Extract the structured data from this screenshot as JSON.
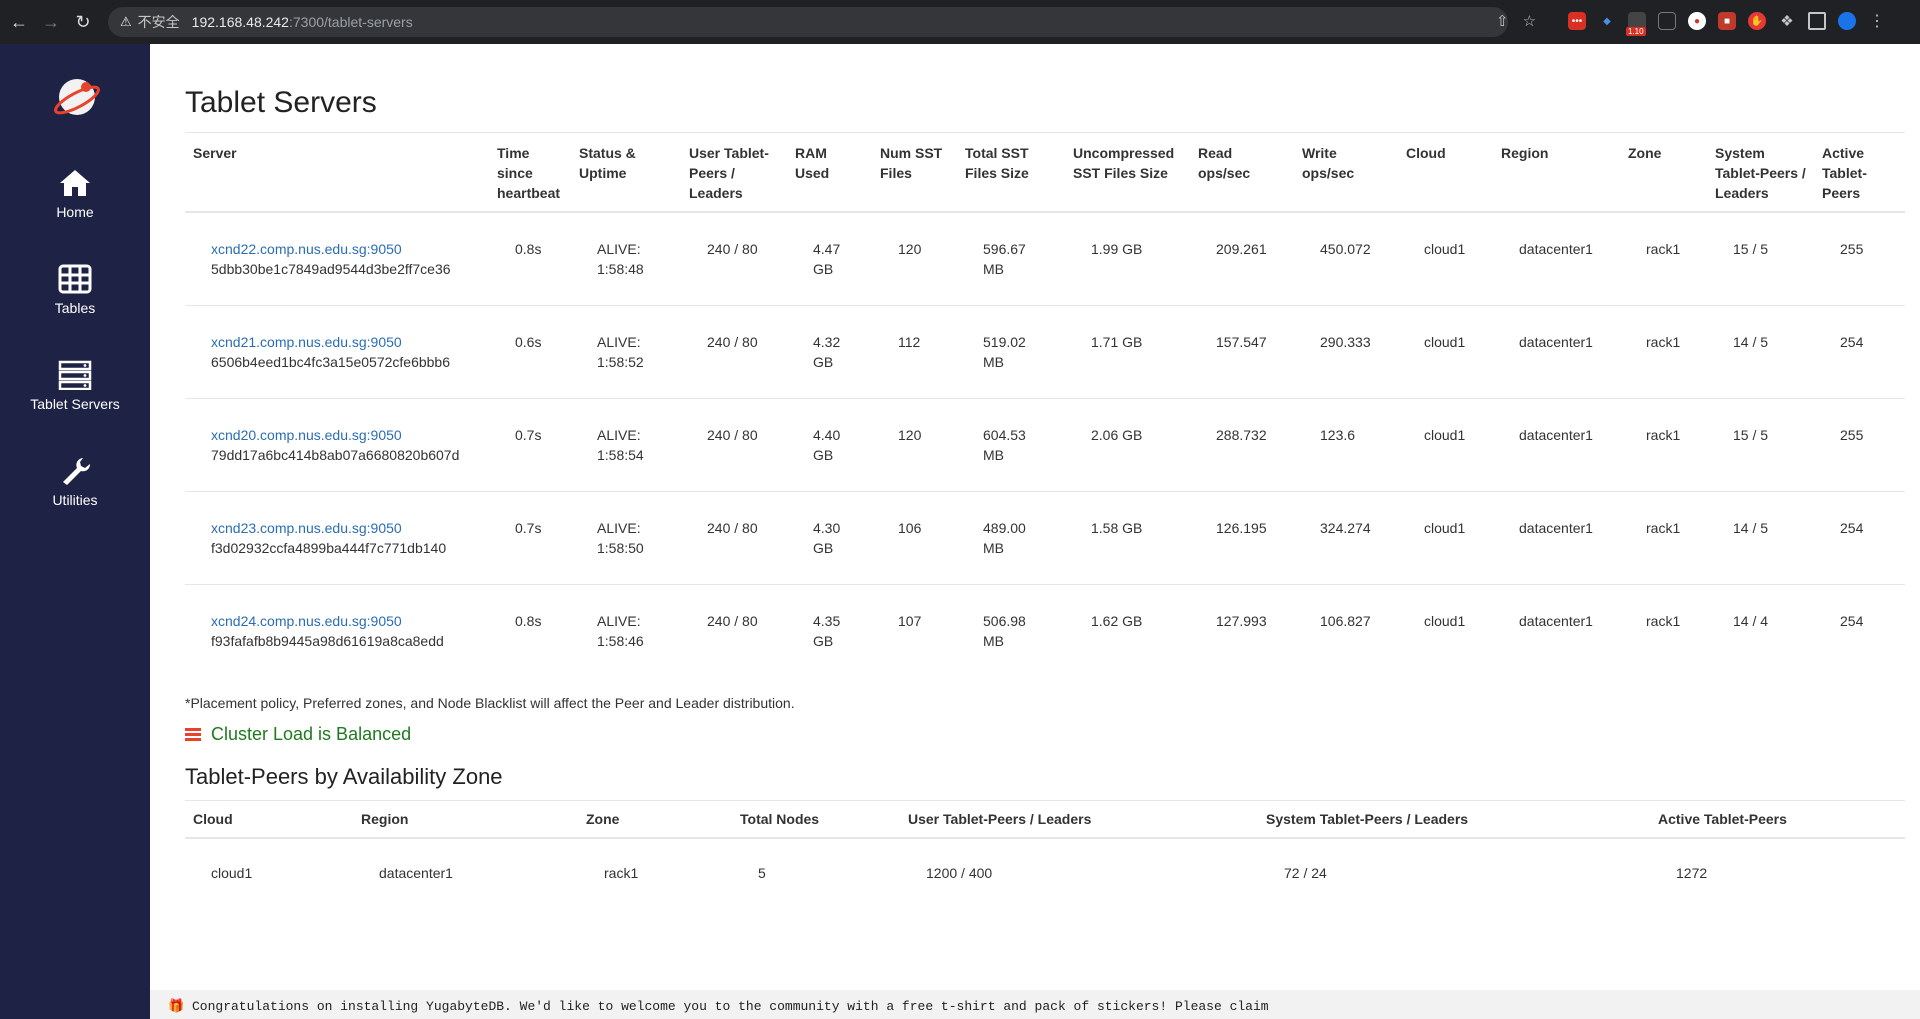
{
  "browser": {
    "warning_label": "不安全",
    "url_host": "192.168.48.242",
    "url_path": ":7300/tablet-servers",
    "badge_count": "1.10"
  },
  "sidebar": {
    "items": [
      {
        "label": "Home",
        "icon": "home-icon"
      },
      {
        "label": "Tables",
        "icon": "table-grid-icon"
      },
      {
        "label": "Tablet Servers",
        "icon": "server-stack-icon"
      },
      {
        "label": "Utilities",
        "icon": "wrench-icon"
      }
    ]
  },
  "page": {
    "title": "Tablet Servers",
    "note": "*Placement policy, Preferred zones, and Node Blacklist will affect the Peer and Leader distribution.",
    "balance_status": "Cluster Load is Balanced",
    "zones_title": "Tablet-Peers by Availability Zone"
  },
  "servers_table": {
    "headers": [
      "Server",
      "Time since heartbeat",
      "Status & Uptime",
      "User Tablet-Peers / Leaders",
      "RAM Used",
      "Num SST Files",
      "Total SST Files Size",
      "Uncompressed SST Files Size",
      "Read ops/sec",
      "Write ops/sec",
      "Cloud",
      "Region",
      "Zone",
      "System Tablet-Peers / Leaders",
      "Active Tablet-Peers"
    ],
    "rows": [
      {
        "host": "xcnd22.comp.nus.edu.sg:9050",
        "uuid": "5dbb30be1c7849ad9544d3be2ff7ce36",
        "heartbeat": "0.8s",
        "status": "ALIVE:",
        "uptime": "1:58:48",
        "user_peers": "240 / 80",
        "ram": "4.47",
        "ram_unit": "GB",
        "sst_files": "120",
        "sst_size": "596.67",
        "sst_size_unit": "MB",
        "uncompressed": "1.99 GB",
        "read_ops": "209.261",
        "write_ops": "450.072",
        "cloud": "cloud1",
        "region": "datacenter1",
        "zone": "rack1",
        "sys_peers": "15 / 5",
        "active": "255"
      },
      {
        "host": "xcnd21.comp.nus.edu.sg:9050",
        "uuid": "6506b4eed1bc4fc3a15e0572cfe6bbb6",
        "heartbeat": "0.6s",
        "status": "ALIVE:",
        "uptime": "1:58:52",
        "user_peers": "240 / 80",
        "ram": "4.32",
        "ram_unit": "GB",
        "sst_files": "112",
        "sst_size": "519.02",
        "sst_size_unit": "MB",
        "uncompressed": "1.71 GB",
        "read_ops": "157.547",
        "write_ops": "290.333",
        "cloud": "cloud1",
        "region": "datacenter1",
        "zone": "rack1",
        "sys_peers": "14 / 5",
        "active": "254"
      },
      {
        "host": "xcnd20.comp.nus.edu.sg:9050",
        "uuid": "79dd17a6bc414b8ab07a6680820b607d",
        "heartbeat": "0.7s",
        "status": "ALIVE:",
        "uptime": "1:58:54",
        "user_peers": "240 / 80",
        "ram": "4.40",
        "ram_unit": "GB",
        "sst_files": "120",
        "sst_size": "604.53",
        "sst_size_unit": "MB",
        "uncompressed": "2.06 GB",
        "read_ops": "288.732",
        "write_ops": "123.6",
        "cloud": "cloud1",
        "region": "datacenter1",
        "zone": "rack1",
        "sys_peers": "15 / 5",
        "active": "255"
      },
      {
        "host": "xcnd23.comp.nus.edu.sg:9050",
        "uuid": "f3d02932ccfa4899ba444f7c771db140",
        "heartbeat": "0.7s",
        "status": "ALIVE:",
        "uptime": "1:58:50",
        "user_peers": "240 / 80",
        "ram": "4.30",
        "ram_unit": "GB",
        "sst_files": "106",
        "sst_size": "489.00",
        "sst_size_unit": "MB",
        "uncompressed": "1.58 GB",
        "read_ops": "126.195",
        "write_ops": "324.274",
        "cloud": "cloud1",
        "region": "datacenter1",
        "zone": "rack1",
        "sys_peers": "14 / 5",
        "active": "254"
      },
      {
        "host": "xcnd24.comp.nus.edu.sg:9050",
        "uuid": "f93fafafb8b9445a98d61619a8ca8edd",
        "heartbeat": "0.8s",
        "status": "ALIVE:",
        "uptime": "1:58:46",
        "user_peers": "240 / 80",
        "ram": "4.35",
        "ram_unit": "GB",
        "sst_files": "107",
        "sst_size": "506.98",
        "sst_size_unit": "MB",
        "uncompressed": "1.62 GB",
        "read_ops": "127.993",
        "write_ops": "106.827",
        "cloud": "cloud1",
        "region": "datacenter1",
        "zone": "rack1",
        "sys_peers": "14 / 4",
        "active": "254"
      }
    ]
  },
  "zones_table": {
    "headers": [
      "Cloud",
      "Region",
      "Zone",
      "Total Nodes",
      "User Tablet-Peers / Leaders",
      "System Tablet-Peers / Leaders",
      "Active Tablet-Peers"
    ],
    "rows": [
      {
        "cloud": "cloud1",
        "region": "datacenter1",
        "zone": "rack1",
        "nodes": "5",
        "user_peers": "1200 / 400",
        "sys_peers": "72 / 24",
        "active": "1272"
      }
    ]
  },
  "footer": {
    "text": "Congratulations on installing YugabyteDB. We'd like to welcome you to the community with a free t-shirt and pack of stickers! Please claim"
  },
  "colors": {
    "sidebar_bg": "#1e2346",
    "link": "#2a6db3",
    "alive": "#1f8a1f",
    "balanced": "#1f7a1f"
  }
}
